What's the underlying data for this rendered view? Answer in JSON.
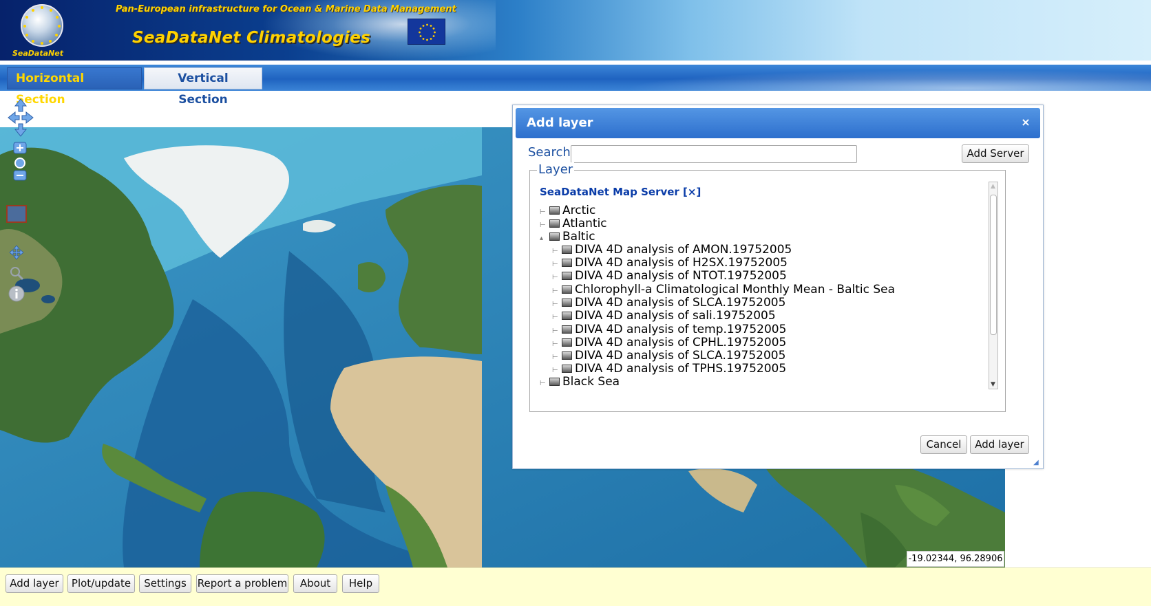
{
  "header": {
    "logo_text": "SeaDataNet",
    "tagline": "Pan-European infrastructure for Ocean & Marine Data Management",
    "title": "SeaDataNet Climatologies"
  },
  "tabs": [
    {
      "label": "Horizontal Section",
      "active": true
    },
    {
      "label": "Vertical Section",
      "active": false
    }
  ],
  "map": {
    "coordinates": "-19.02344, 96.28906"
  },
  "dialog": {
    "title": "Add layer",
    "close_glyph": "×",
    "search_label": "Search:",
    "search_value": "",
    "add_server_label": "Add Server",
    "layer_legend": "Layer",
    "server_title": "SeaDataNet Map Server [×]",
    "tree": [
      {
        "label": "Arctic",
        "expanded": false
      },
      {
        "label": "Atlantic",
        "expanded": false
      },
      {
        "label": "Baltic",
        "expanded": true
      },
      {
        "label": "DIVA 4D analysis of AMON.19752005"
      },
      {
        "label": "DIVA 4D analysis of H2SX.19752005"
      },
      {
        "label": "DIVA 4D analysis of NTOT.19752005"
      },
      {
        "label": "Chlorophyll-a Climatological Monthly Mean - Baltic Sea"
      },
      {
        "label": "DIVA 4D analysis of SLCA.19752005"
      },
      {
        "label": "DIVA 4D analysis of sali.19752005"
      },
      {
        "label": "DIVA 4D analysis of temp.19752005"
      },
      {
        "label": "DIVA 4D analysis of CPHL.19752005"
      },
      {
        "label": "DIVA 4D analysis of SLCA.19752005"
      },
      {
        "label": "DIVA 4D analysis of TPHS.19752005"
      },
      {
        "label": "Black Sea",
        "expanded": false
      }
    ],
    "cancel_label": "Cancel",
    "add_layer_label": "Add layer"
  },
  "toolbar": {
    "add_layer": "Add layer",
    "plot_update": "Plot/update",
    "settings": "Settings",
    "report": "Report a problem",
    "about": "About",
    "help": "Help"
  },
  "colors": {
    "accent_yellow": "#ffd200",
    "header_blue": "#1f63c0",
    "tree_link_blue": "#0a3ca8",
    "toolbar_bg": "#ffffd2"
  }
}
